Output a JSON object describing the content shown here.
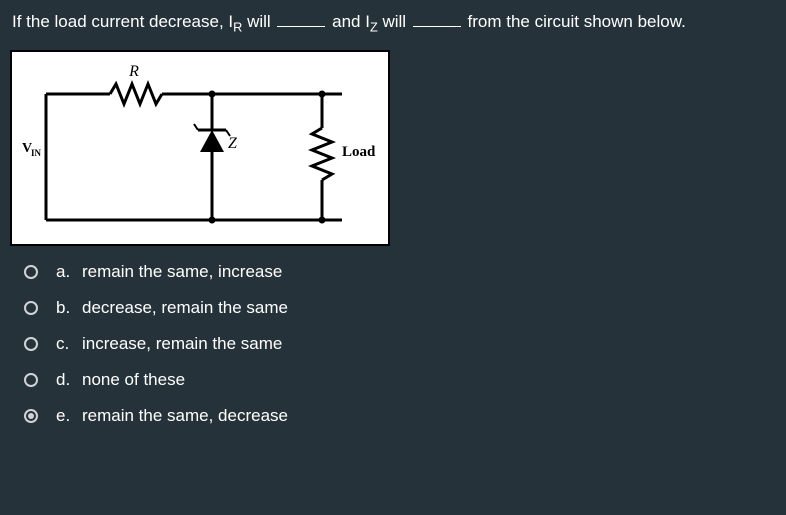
{
  "question": {
    "stem_part1": "If the load current decrease, I",
    "stem_sub1": "R",
    "stem_part2": " will ",
    "stem_part3": " and I",
    "stem_sub2": "Z",
    "stem_part4": " will ",
    "stem_part5": " from the circuit shown below."
  },
  "diagram": {
    "vin": "V",
    "vin_sub": "IN",
    "r": "R",
    "z": "Z",
    "load": "Load"
  },
  "answers": [
    {
      "letter": "a.",
      "text": "remain the same, increase",
      "selected": false
    },
    {
      "letter": "b.",
      "text": "decrease, remain the same",
      "selected": false
    },
    {
      "letter": "c.",
      "text": "increase, remain the same",
      "selected": false
    },
    {
      "letter": "d.",
      "text": "none of these",
      "selected": false
    },
    {
      "letter": "e.",
      "text": "remain the same, decrease",
      "selected": true
    }
  ]
}
